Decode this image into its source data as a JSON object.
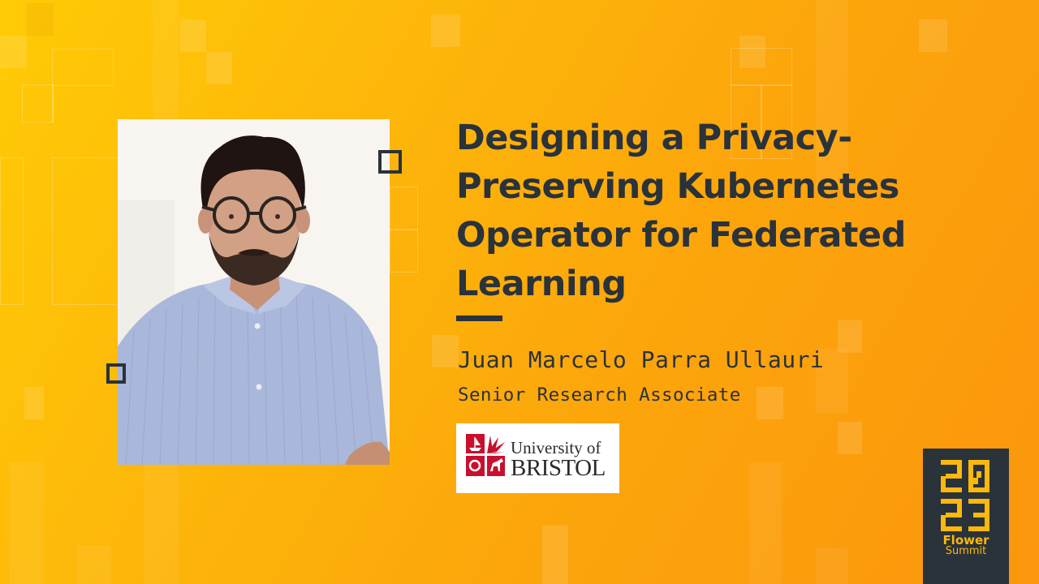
{
  "talk": {
    "title_lines": [
      "Designing a Privacy-",
      "Preserving Kubernetes",
      "Operator for Federated",
      "Learning"
    ]
  },
  "speaker": {
    "name": "Juan Marcelo Parra Ullauri",
    "role": "Senior Research Associate",
    "photo_description": "portrait-photo"
  },
  "affiliation": {
    "line1": "University of",
    "line2": "BRISTOL"
  },
  "event_badge": {
    "year_top": "20",
    "year_bottom": "23",
    "name_line1": "Flower",
    "name_line2": "Summit"
  },
  "colors": {
    "background_start": "#ffcb05",
    "background_end": "#fb960d",
    "text_dark": "#2a323a",
    "badge_accent": "#fcb80c",
    "bristol_red": "#c8102e"
  }
}
